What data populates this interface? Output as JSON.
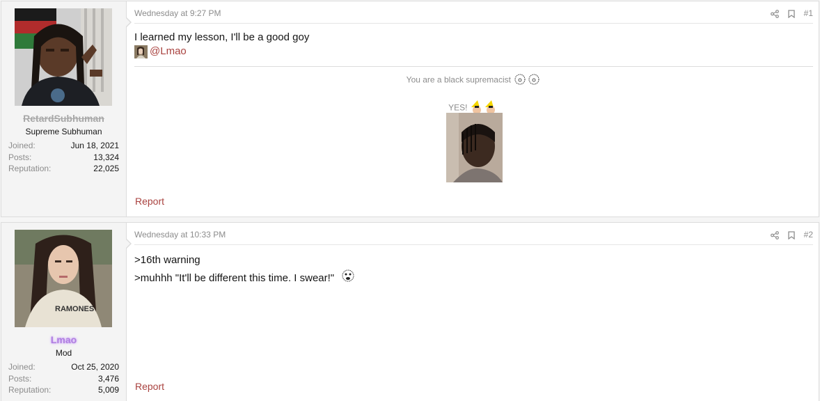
{
  "posts": [
    {
      "user": {
        "name": "RetardSubhuman",
        "title": "Supreme Subhuman",
        "stats": [
          {
            "label": "Joined:",
            "value": "Jun 18, 2021"
          },
          {
            "label": "Posts:",
            "value": "13,324"
          },
          {
            "label": "Reputation:",
            "value": "22,025"
          }
        ]
      },
      "date": "Wednesday at 9:27 PM",
      "number": "#1",
      "line1": "I learned my lesson, I'll be a good goy",
      "mention": "@Lmao",
      "quote_caption": "You are a black supremacist",
      "yes_caption": "YES!",
      "report": "Report"
    },
    {
      "user": {
        "name": "Lmao",
        "title": "Mod",
        "stats": [
          {
            "label": "Joined:",
            "value": "Oct 25, 2020"
          },
          {
            "label": "Posts:",
            "value": "3,476"
          },
          {
            "label": "Reputation:",
            "value": "5,009"
          }
        ]
      },
      "date": "Wednesday at 10:33 PM",
      "number": "#2",
      "line1": ">16th warning",
      "line2": ">muhhh \"It'll be different this time. I swear!\"",
      "report": "Report"
    }
  ],
  "icons": {
    "share": "share-icon",
    "bookmark": "bookmark-icon"
  },
  "colors": {
    "link": "#a9423f",
    "mod_name": "#b07fe0",
    "banned_name": "#a8a8a8"
  }
}
